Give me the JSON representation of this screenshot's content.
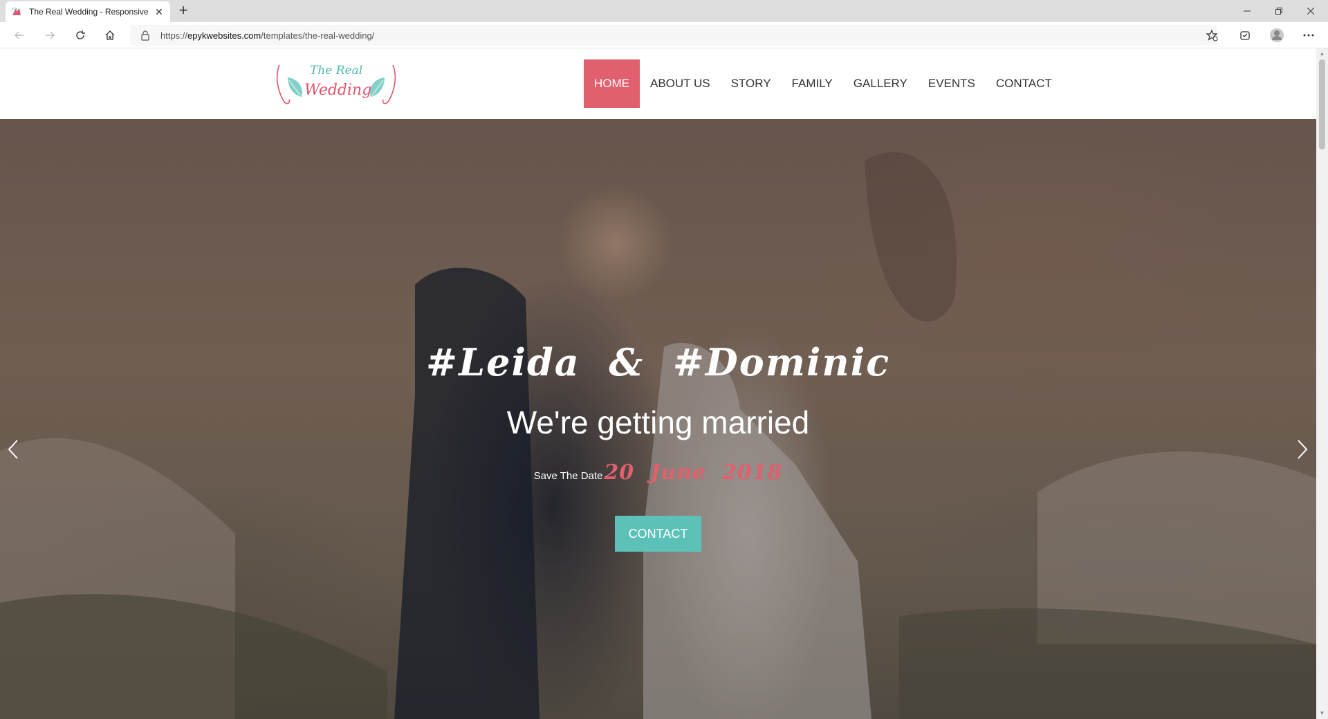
{
  "browser": {
    "tab_title": "The Real Wedding - Responsive",
    "new_tab_icon": "plus-icon",
    "url_prefix": "https://",
    "url_host": "epykwebsites.com",
    "url_path": "/templates/the-real-wedding/"
  },
  "site": {
    "logo_line1": "The Real",
    "logo_line2": "Wedding",
    "nav": [
      {
        "label": "HOME",
        "active": true
      },
      {
        "label": "ABOUT US"
      },
      {
        "label": "STORY"
      },
      {
        "label": "FAMILY"
      },
      {
        "label": "GALLERY"
      },
      {
        "label": "EVENTS"
      },
      {
        "label": "CONTACT"
      }
    ],
    "accent_color": "#e0606e",
    "teal_color": "#5cc2b9"
  },
  "hero": {
    "names": "#Leida  &  #Dominic",
    "tagline": "We're getting married",
    "save_label": "Save The Date",
    "save_date": "20  June  2018",
    "contact_label": "CONTACT"
  }
}
